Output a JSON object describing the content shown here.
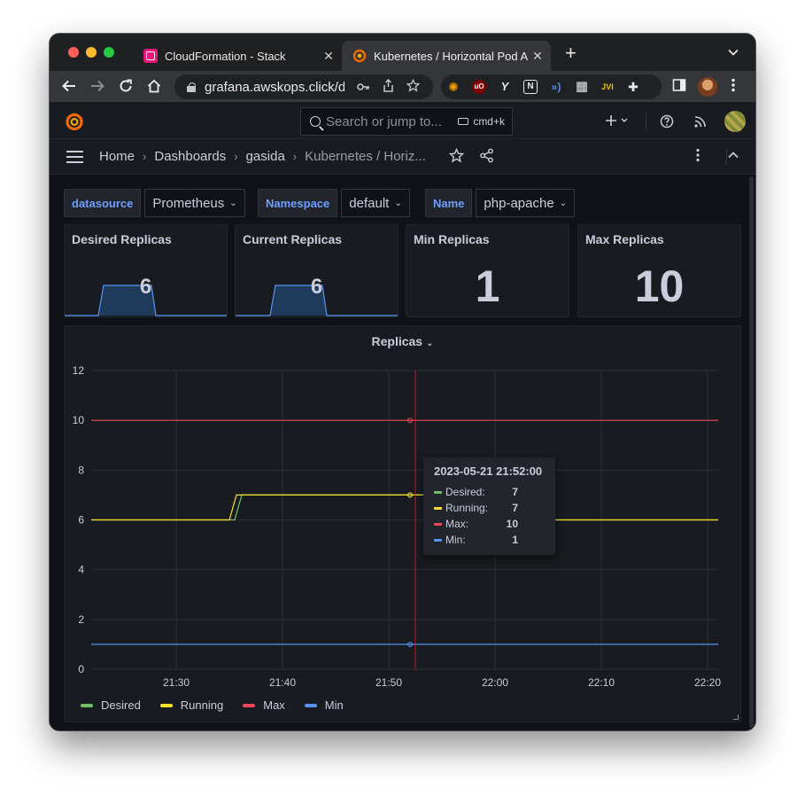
{
  "browser": {
    "tabs": [
      {
        "title": "CloudFormation - Stack",
        "close": "✕"
      },
      {
        "title": "Kubernetes / Horizontal Pod Autoscaler",
        "close": "✕"
      }
    ],
    "new_tab": "+",
    "tab_menu": "⌄",
    "url": "grafana.awskops.click/d/...",
    "extensions": [
      {
        "label": "✺",
        "color": "#f0a000"
      },
      {
        "label": "uO",
        "color": "#800000"
      },
      {
        "label": "Y",
        "color": "#e8eaed"
      },
      {
        "label": "N",
        "color": "#e8eaed"
      },
      {
        "label": "»)",
        "color": "#4f8cff"
      },
      {
        "label": "▦",
        "color": "#e8eaed"
      },
      {
        "label": "JVI",
        "color": "#f0c000"
      },
      {
        "label": "✚",
        "color": "#e8eaed"
      }
    ]
  },
  "grafana": {
    "search_placeholder": "Search or jump to...",
    "search_shortcut": "cmd+k",
    "breadcrumbs": [
      "Home",
      "Dashboards",
      "gasida",
      "Kubernetes / Horiz..."
    ],
    "variables": [
      {
        "label": "datasource",
        "value": "Prometheus"
      },
      {
        "label": "Namespace",
        "value": "default"
      },
      {
        "label": "Name",
        "value": "php-apache"
      }
    ],
    "stats": [
      {
        "title": "Desired Replicas",
        "value": "6"
      },
      {
        "title": "Current Replicas",
        "value": "6"
      },
      {
        "title": "Min Replicas",
        "value": "1"
      },
      {
        "title": "Max Replicas",
        "value": "10"
      }
    ],
    "graph_title": "Replicas",
    "tooltip": {
      "time": "2023-05-21 21:52:00",
      "rows": [
        {
          "name": "Desired:",
          "value": "7",
          "color": "#73bf69"
        },
        {
          "name": "Running:",
          "value": "7",
          "color": "#fade2a"
        },
        {
          "name": "Max:",
          "value": "10",
          "color": "#f2495c"
        },
        {
          "name": "Min:",
          "value": "1",
          "color": "#5794f2"
        }
      ]
    },
    "legend": [
      {
        "name": "Desired",
        "color": "#73bf69"
      },
      {
        "name": "Running",
        "color": "#fade2a"
      },
      {
        "name": "Max",
        "color": "#f2495c"
      },
      {
        "name": "Min",
        "color": "#5794f2"
      }
    ]
  },
  "chart_data": {
    "type": "line",
    "title": "Replicas",
    "ylim": [
      0,
      12
    ],
    "y_ticks": [
      0,
      2,
      4,
      6,
      8,
      10,
      12
    ],
    "x_range": [
      "21:22",
      "22:21"
    ],
    "x_ticks": [
      "21:30",
      "21:40",
      "21:50",
      "22:00",
      "22:10",
      "22:20"
    ],
    "grid": true,
    "legend_position": "bottom-left",
    "hover_time": "21:52",
    "series": [
      {
        "name": "Desired",
        "color": "#73bf69",
        "points": [
          [
            "21:22",
            6
          ],
          [
            "21:35:30",
            6
          ],
          [
            "21:36:10",
            7
          ],
          [
            "22:00",
            7
          ],
          [
            "22:00",
            6
          ],
          [
            "22:21",
            6
          ]
        ]
      },
      {
        "name": "Running",
        "color": "#fade2a",
        "points": [
          [
            "21:22",
            6
          ],
          [
            "21:35",
            6
          ],
          [
            "21:35:40",
            7
          ],
          [
            "22:00",
            7
          ],
          [
            "22:00",
            6
          ],
          [
            "22:21",
            6
          ]
        ]
      },
      {
        "name": "Max",
        "color": "#f2495c",
        "points": [
          [
            "21:22",
            10
          ],
          [
            "22:21",
            10
          ]
        ]
      },
      {
        "name": "Min",
        "color": "#5794f2",
        "points": [
          [
            "21:22",
            1
          ],
          [
            "22:21",
            1
          ]
        ]
      }
    ]
  }
}
